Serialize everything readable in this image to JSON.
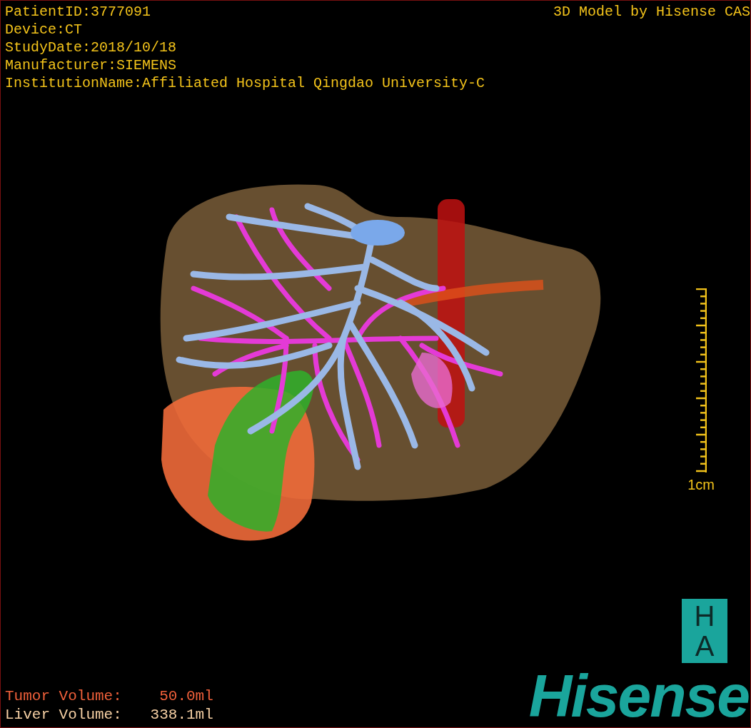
{
  "header": {
    "lines": [
      "PatientID:3777091",
      "Device:CT",
      "StudyDate:2018/10/18",
      "Manufacturer:SIEMENS",
      "InstitutionName:Affiliated Hospital Qingdao University-C"
    ],
    "title": "3D Model by Hisense CAS"
  },
  "scale": {
    "label": "1cm"
  },
  "volumes": [
    {
      "kind": "tumor",
      "label": "Tumor Volume:",
      "value": "50.0ml"
    },
    {
      "kind": "liver",
      "label": "Liver Volume:",
      "value": "338.1ml"
    }
  ],
  "logo": {
    "badge_top": "H",
    "badge_bottom": "A",
    "brand": "Hisense"
  }
}
